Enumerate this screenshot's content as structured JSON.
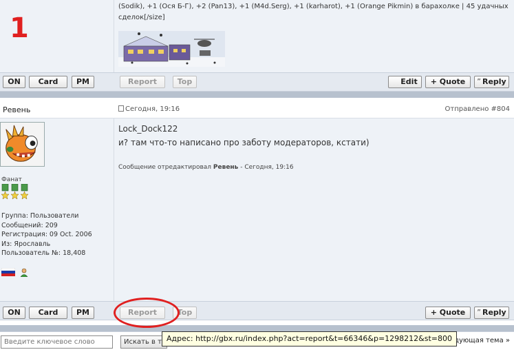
{
  "annotation": {
    "number": "1"
  },
  "top_post": {
    "signature_text": "(Sodik), +1 (Ося Б-Г), +2 (Pan13), +1 (M4d.Serg), +1 (karharot), +1 (Orange Pikmin) в барахолке | 45 удачных сделок[/size]"
  },
  "buttons": {
    "on": "ON",
    "card": "Card",
    "pm": "PM",
    "report": "Report",
    "top": "Top",
    "edit": "Edit",
    "quote": "+ Quote",
    "reply": "Reply"
  },
  "post": {
    "author": "Ревень",
    "date": "Сегодня, 19:16",
    "post_number": "Отправлено #804",
    "rank": "Фанат",
    "user_info": {
      "group": "Группа: Пользователи",
      "messages": "Сообщений: 209",
      "registration": "Регистрация: 09 Oct. 2006",
      "from": "Из: Ярославль",
      "user_number": "Пользователь №: 18,408"
    },
    "quote_name": "Lock_Dock122",
    "message": "и? там что-то написано про заботу модераторов, кстати)",
    "edit_note_prefix": "Сообщение отредактировал ",
    "edit_note_author": "Ревень",
    "edit_note_suffix": " - Сегодня, 19:16"
  },
  "search": {
    "placeholder": "Введите ключевое слово",
    "button": "Искать в т"
  },
  "status_tooltip": "Адрес: http://gbx.ru/index.php?act=report&t=66346&p=1298212&st=800",
  "next_topic": {
    "partial": "ы",
    "label": "Следующая тема »"
  },
  "colors": {
    "accent_red": "#e02020",
    "panel_bg": "#eef2f7",
    "separator": "#b7c1ce"
  }
}
